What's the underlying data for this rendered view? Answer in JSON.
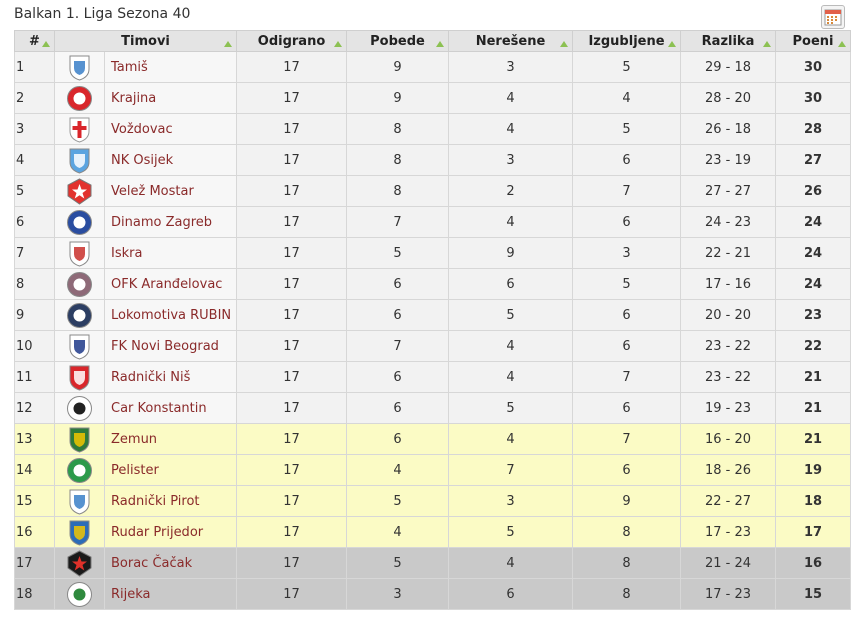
{
  "title": "Balkan 1. Liga Sezona 40",
  "calendar_icon": "calendar-icon",
  "columns": [
    "#",
    "Timovi",
    "Odigrano",
    "Pobede",
    "Nerešene",
    "Izgubljene",
    "Razlika",
    "Poeni"
  ],
  "row_colors": {
    "normal": "#f2f2f2",
    "promotion_zone": "#fbfbc5",
    "relegation_zone": "#c9c9c9"
  },
  "rows": [
    {
      "pos": "1",
      "team": "Tamiš",
      "played": "17",
      "won": "9",
      "drawn": "3",
      "lost": "5",
      "diff": "29 - 18",
      "points": "30",
      "zone": "normal",
      "crest": {
        "type": "shield",
        "bg": "#ffffff",
        "fg": "#3a7fc8"
      }
    },
    {
      "pos": "2",
      "team": "Krajina",
      "played": "17",
      "won": "9",
      "drawn": "4",
      "lost": "4",
      "diff": "28 - 20",
      "points": "30",
      "zone": "normal",
      "crest": {
        "type": "ball",
        "bg": "#d9262b",
        "fg": "#ffffff"
      }
    },
    {
      "pos": "3",
      "team": "Voždovac",
      "played": "17",
      "won": "8",
      "drawn": "4",
      "lost": "5",
      "diff": "26 - 18",
      "points": "28",
      "zone": "normal",
      "crest": {
        "type": "cross",
        "bg": "#ffffff",
        "fg": "#d9262b"
      }
    },
    {
      "pos": "4",
      "team": "NK Osijek",
      "played": "17",
      "won": "8",
      "drawn": "3",
      "lost": "6",
      "diff": "23 - 19",
      "points": "27",
      "zone": "normal",
      "crest": {
        "type": "shield",
        "bg": "#5ba4e0",
        "fg": "#ffffff"
      }
    },
    {
      "pos": "5",
      "team": "Velež Mostar",
      "played": "17",
      "won": "8",
      "drawn": "2",
      "lost": "7",
      "diff": "27 - 27",
      "points": "26",
      "zone": "normal",
      "crest": {
        "type": "star",
        "bg": "#e2322e",
        "fg": "#ffffff"
      }
    },
    {
      "pos": "6",
      "team": "Dinamo Zagreb",
      "played": "17",
      "won": "7",
      "drawn": "4",
      "lost": "6",
      "diff": "24 - 23",
      "points": "24",
      "zone": "normal",
      "crest": {
        "type": "circle",
        "bg": "#2a4da0",
        "fg": "#ffffff"
      }
    },
    {
      "pos": "7",
      "team": "Iskra",
      "played": "17",
      "won": "5",
      "drawn": "9",
      "lost": "3",
      "diff": "22 - 21",
      "points": "24",
      "zone": "normal",
      "crest": {
        "type": "shield",
        "bg": "#ffffff",
        "fg": "#c9302c"
      }
    },
    {
      "pos": "8",
      "team": "OFK Aranđelovac",
      "played": "17",
      "won": "6",
      "drawn": "6",
      "lost": "5",
      "diff": "17 - 16",
      "points": "24",
      "zone": "normal",
      "crest": {
        "type": "circle",
        "bg": "#8e6a78",
        "fg": "#ffffff"
      }
    },
    {
      "pos": "9",
      "team": "Lokomotiva RUBIN",
      "played": "17",
      "won": "6",
      "drawn": "5",
      "lost": "6",
      "diff": "20 - 20",
      "points": "23",
      "zone": "normal",
      "crest": {
        "type": "circle",
        "bg": "#2c3e63",
        "fg": "#ffffff"
      }
    },
    {
      "pos": "10",
      "team": "FK Novi Beograd",
      "played": "17",
      "won": "7",
      "drawn": "4",
      "lost": "6",
      "diff": "23 - 22",
      "points": "22",
      "zone": "normal",
      "crest": {
        "type": "shield",
        "bg": "#ffffff",
        "fg": "#1e3a8a"
      }
    },
    {
      "pos": "11",
      "team": "Radnički Niš",
      "played": "17",
      "won": "6",
      "drawn": "4",
      "lost": "7",
      "diff": "23 - 22",
      "points": "21",
      "zone": "normal",
      "crest": {
        "type": "shield",
        "bg": "#d9262b",
        "fg": "#ffffff"
      }
    },
    {
      "pos": "12",
      "team": "Car Konstantin",
      "played": "17",
      "won": "6",
      "drawn": "5",
      "lost": "6",
      "diff": "19 - 23",
      "points": "21",
      "zone": "normal",
      "crest": {
        "type": "circle",
        "bg": "#ffffff",
        "fg": "#222222"
      }
    },
    {
      "pos": "13",
      "team": "Zemun",
      "played": "17",
      "won": "6",
      "drawn": "4",
      "lost": "7",
      "diff": "16 - 20",
      "points": "21",
      "zone": "promotion_zone",
      "crest": {
        "type": "shield",
        "bg": "#2f7a3a",
        "fg": "#f2c500"
      }
    },
    {
      "pos": "14",
      "team": "Pelister",
      "played": "17",
      "won": "4",
      "drawn": "7",
      "lost": "6",
      "diff": "18 - 26",
      "points": "19",
      "zone": "promotion_zone",
      "crest": {
        "type": "circle",
        "bg": "#2c9a4a",
        "fg": "#ffffff"
      }
    },
    {
      "pos": "15",
      "team": "Radnički Pirot",
      "played": "17",
      "won": "5",
      "drawn": "3",
      "lost": "9",
      "diff": "22 - 27",
      "points": "18",
      "zone": "promotion_zone",
      "crest": {
        "type": "shield",
        "bg": "#ffffff",
        "fg": "#3a7fc8"
      }
    },
    {
      "pos": "16",
      "team": "Rudar Prijedor",
      "played": "17",
      "won": "4",
      "drawn": "5",
      "lost": "8",
      "diff": "17 - 23",
      "points": "17",
      "zone": "promotion_zone",
      "crest": {
        "type": "shield",
        "bg": "#2b6cb8",
        "fg": "#f2c500"
      }
    },
    {
      "pos": "17",
      "team": "Borac Čačak",
      "played": "17",
      "won": "5",
      "drawn": "4",
      "lost": "8",
      "diff": "21 - 24",
      "points": "16",
      "zone": "relegation_zone",
      "crest": {
        "type": "star",
        "bg": "#1a1a1a",
        "fg": "#e0312a"
      }
    },
    {
      "pos": "18",
      "team": "Rijeka",
      "played": "17",
      "won": "3",
      "drawn": "6",
      "lost": "8",
      "diff": "17 - 23",
      "points": "15",
      "zone": "relegation_zone",
      "crest": {
        "type": "circle",
        "bg": "#ffffff",
        "fg": "#2f8a3e"
      }
    }
  ]
}
